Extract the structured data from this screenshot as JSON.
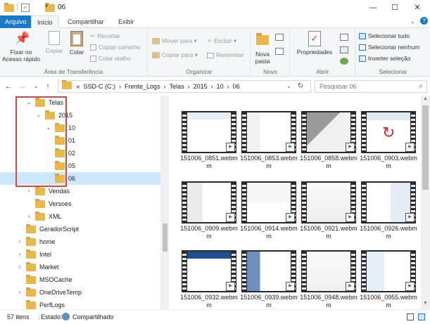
{
  "window": {
    "title": "06",
    "minimize": "—",
    "maximize": "☐",
    "close": "✕"
  },
  "tabs": {
    "file": "Arquivo",
    "home": "Início",
    "share": "Compartilhar",
    "view": "Exibir"
  },
  "ribbon": {
    "clipboard": {
      "label": "Área de Transferência",
      "pin": "Fixar no Acesso rápido",
      "pin_l1": "Fixar no",
      "pin_l2": "Acesso rápido",
      "copy": "Copiar",
      "paste": "Colar",
      "cut": "Recortar",
      "copy_path": "Copiar caminho",
      "paste_shortcut": "Colar atalho"
    },
    "organize": {
      "label": "Organizar",
      "move_to": "Mover para",
      "copy_to": "Copiar para",
      "delete": "Excluir",
      "rename": "Renomear"
    },
    "new": {
      "label": "Novo",
      "new_folder_l1": "Nova",
      "new_folder_l2": "pasta"
    },
    "open": {
      "label": "Abrir",
      "properties": "Propriedades"
    },
    "select": {
      "label": "Selecionar",
      "select_all": "Selecionar tudo",
      "select_none": "Selecionar nenhum",
      "invert": "Inverter seleção"
    }
  },
  "address": {
    "crumbs": [
      "«",
      "SSD-C (C:)",
      "›",
      "Frente_Logs",
      "›",
      "Telas",
      "›",
      "2015",
      "›",
      "10",
      "›",
      "06"
    ],
    "search_placeholder": "Pesquisar 06"
  },
  "tree": [
    {
      "label": "Telas",
      "level": 1,
      "expanded": true
    },
    {
      "label": "2015",
      "level": 2,
      "expanded": true
    },
    {
      "label": "10",
      "level": 3,
      "expanded": true
    },
    {
      "label": "01",
      "level": 4
    },
    {
      "label": "02",
      "level": 4
    },
    {
      "label": "05",
      "level": 4
    },
    {
      "label": "06",
      "level": 4,
      "selected": true
    },
    {
      "label": "Vendas",
      "level": 1,
      "collapsed": true
    },
    {
      "label": "Versoes",
      "level": 1
    },
    {
      "label": "XML",
      "level": 1,
      "collapsed": true
    },
    {
      "label": "GeradorScript",
      "level": 0
    },
    {
      "label": "home",
      "level": 0,
      "collapsed": true
    },
    {
      "label": "Intel",
      "level": 0,
      "collapsed": true
    },
    {
      "label": "Market",
      "level": 0,
      "collapsed": true
    },
    {
      "label": "MSOCache",
      "level": 0
    },
    {
      "label": "OneDriveTemp",
      "level": 0,
      "collapsed": true
    },
    {
      "label": "PerfLogs",
      "level": 0
    }
  ],
  "files": [
    {
      "l1": "151006_0851.webm",
      "l2": "m",
      "name": "151006_0851.webm"
    },
    {
      "l1": "151006_0853.webm",
      "l2": "m",
      "name": "151006_0853.webm"
    },
    {
      "l1": "151006_0858.webm",
      "l2": "m",
      "name": "151006_0858.webm"
    },
    {
      "l1": "151006_0903.webm",
      "l2": "m",
      "name": "151006_0903.webm"
    },
    {
      "l1": "151006_0909.webm",
      "l2": "m",
      "name": "151006_0909.webm"
    },
    {
      "l1": "151006_0914.webm",
      "l2": "m",
      "name": "151006_0914.webm"
    },
    {
      "l1": "151006_0921.webm",
      "l2": "m",
      "name": "151006_0921.webm"
    },
    {
      "l1": "151006_0926.webm",
      "l2": "m",
      "name": "151006_0926.webm"
    },
    {
      "l1": "151006_0932.webm",
      "l2": "m",
      "name": "151006_0932.webm"
    },
    {
      "l1": "151006_0939.webm",
      "l2": "m",
      "name": "151006_0939.webm"
    },
    {
      "l1": "151006_0948.webm",
      "l2": "m",
      "name": "151006_0948.webm"
    },
    {
      "l1": "151006_0955.webm",
      "l2": "m",
      "name": "151006_0955.webm"
    }
  ],
  "status": {
    "count": "57 itens",
    "state_label": "Estado:",
    "state_value": "Compartilhado"
  },
  "colors": {
    "accent": "#1979ca",
    "selection": "#cce8ff",
    "highlight_box": "#e0433b",
    "folder": "#e8b94a"
  }
}
